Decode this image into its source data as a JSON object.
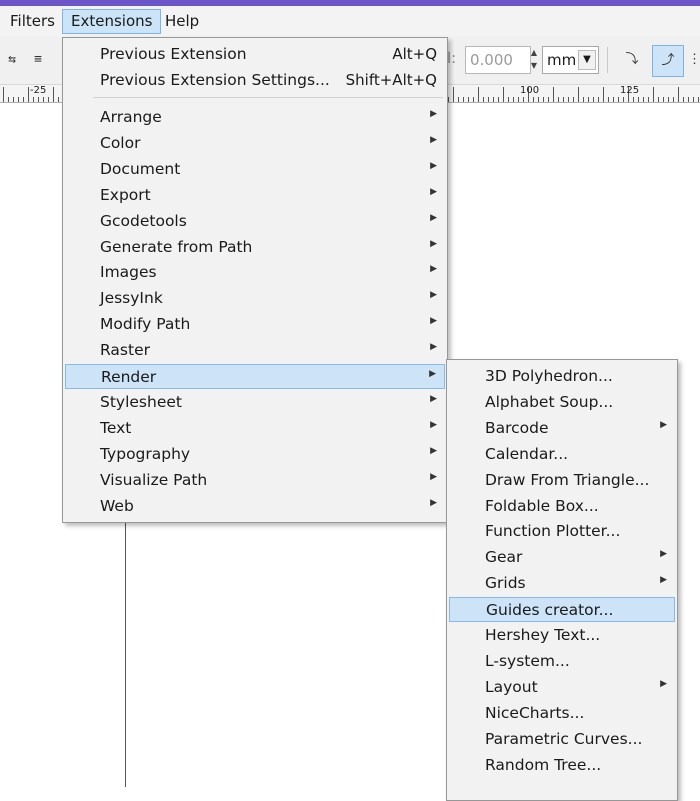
{
  "menubar": {
    "filters": "Filters",
    "extensions": "Extensions",
    "help": "Help"
  },
  "toolbar": {
    "field_label_fragment": "l:",
    "value": "0.000",
    "unit": "mm"
  },
  "ruler": {
    "ticks": [
      "-25",
      "100",
      "125"
    ]
  },
  "extensions_menu": {
    "top_items": [
      {
        "label": "Previous Extension",
        "accel": "Alt+Q"
      },
      {
        "label": "Previous Extension Settings...",
        "accel": "Shift+Alt+Q"
      }
    ],
    "items": [
      {
        "label": "Arrange"
      },
      {
        "label": "Color"
      },
      {
        "label": "Document"
      },
      {
        "label": "Export"
      },
      {
        "label": "Gcodetools"
      },
      {
        "label": "Generate from Path"
      },
      {
        "label": "Images"
      },
      {
        "label": "JessyInk"
      },
      {
        "label": "Modify Path"
      },
      {
        "label": "Raster"
      },
      {
        "label": "Render",
        "highlighted": true
      },
      {
        "label": "Stylesheet"
      },
      {
        "label": "Text"
      },
      {
        "label": "Typography"
      },
      {
        "label": "Visualize Path"
      },
      {
        "label": "Web"
      }
    ]
  },
  "render_submenu": {
    "items": [
      {
        "label": "3D Polyhedron...",
        "has_submenu": false
      },
      {
        "label": "Alphabet Soup...",
        "has_submenu": false
      },
      {
        "label": "Barcode",
        "has_submenu": true
      },
      {
        "label": "Calendar...",
        "has_submenu": false
      },
      {
        "label": "Draw From Triangle...",
        "has_submenu": false
      },
      {
        "label": "Foldable Box...",
        "has_submenu": false
      },
      {
        "label": "Function Plotter...",
        "has_submenu": false
      },
      {
        "label": "Gear",
        "has_submenu": true
      },
      {
        "label": "Grids",
        "has_submenu": true
      },
      {
        "label": "Guides creator...",
        "has_submenu": false,
        "highlighted": true
      },
      {
        "label": "Hershey Text...",
        "has_submenu": false
      },
      {
        "label": "L-system...",
        "has_submenu": false
      },
      {
        "label": "Layout",
        "has_submenu": true
      },
      {
        "label": "NiceCharts...",
        "has_submenu": false
      },
      {
        "label": "Parametric Curves...",
        "has_submenu": false
      },
      {
        "label": "Random Tree...",
        "has_submenu": false
      }
    ]
  },
  "colors": {
    "highlight": "#cde3f8",
    "highlight_border": "#86b9ec",
    "menu_bg": "#f2f2f2",
    "title_strip": "#6c55c9"
  }
}
